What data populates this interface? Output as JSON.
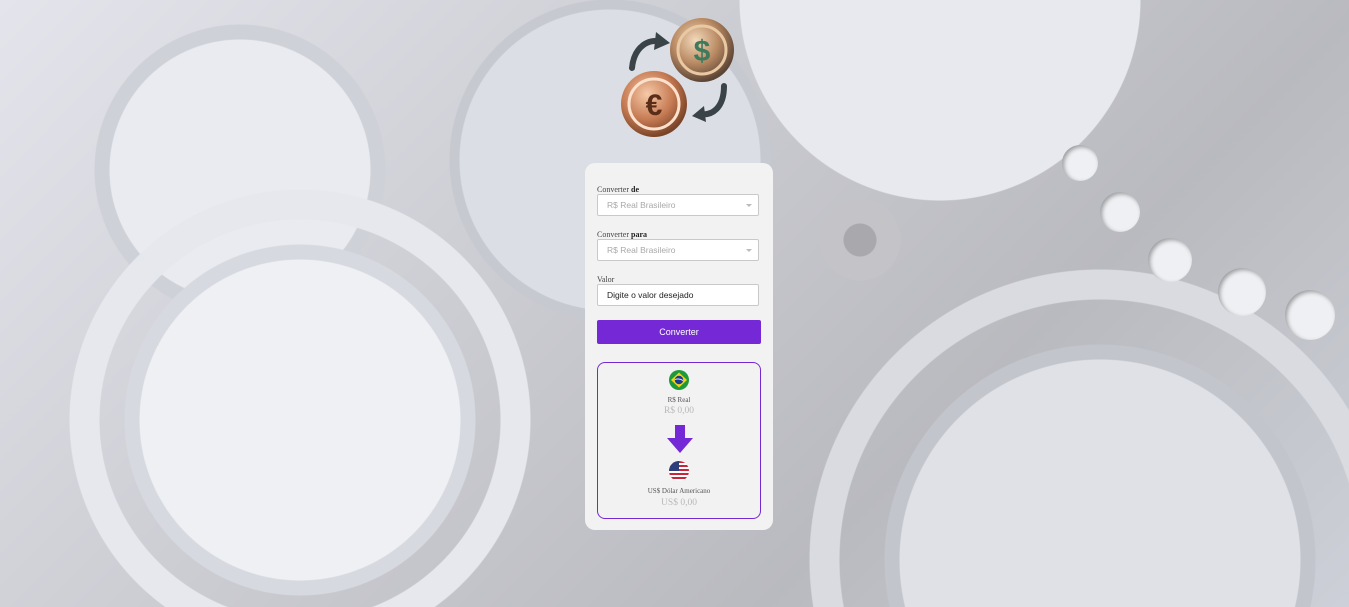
{
  "form": {
    "from_label_prefix": "Converter ",
    "from_label_bold": "de",
    "from_selected": "R$ Real Brasileiro",
    "to_label_prefix": "Converter ",
    "to_label_bold": "para",
    "to_selected": "R$ Real Brasileiro",
    "value_label": "Valor",
    "value_placeholder": "Digite o valor desejado",
    "convert_button": "Converter"
  },
  "result": {
    "from_currency": "R$ Real",
    "from_amount": "R$ 0,00",
    "to_currency": "US$ Dólar Americano",
    "to_amount": "US$ 0,00"
  },
  "colors": {
    "accent": "#7428d6",
    "card_bg": "#f2f2f2"
  },
  "icons": {
    "logo": "currency-exchange-icon",
    "from_flag": "brazil-flag-icon",
    "to_flag": "usa-flag-icon",
    "arrow": "arrow-down-icon"
  }
}
